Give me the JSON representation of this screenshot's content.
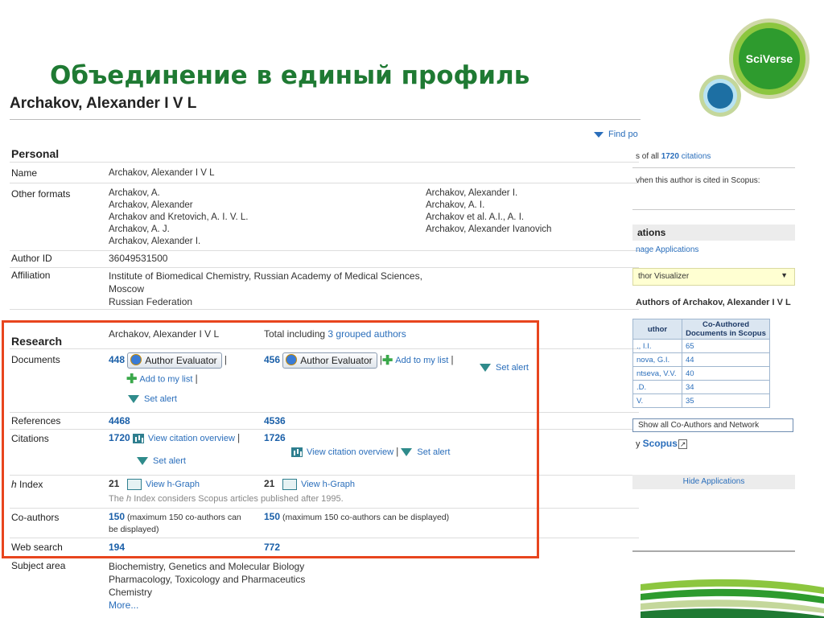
{
  "slide": {
    "title": "Объединение в единый профиль"
  },
  "logo": {
    "text": "SciVerse"
  },
  "profile": {
    "name": "Archakov, Alexander I V L",
    "find_link": "Find po",
    "personal": {
      "heading": "Personal",
      "name_label": "Name",
      "name_value": "Archakov, Alexander I V L",
      "other_formats_label": "Other formats",
      "other_formats_left": [
        "Archakov, A.",
        "Archakov, Alexander",
        "Archakov and Kretovich, A. I. V. L.",
        "Archakov, A. J.",
        "Archakov, Alexander I."
      ],
      "other_formats_right": [
        "Archakov, Alexander I.",
        "Archakov, A. I.",
        "Archakov et al. A.I., A. I.",
        "Archakov, Alexander Ivanovich"
      ],
      "author_id_label": "Author ID",
      "author_id_value": "36049531500",
      "affiliation_label": "Affiliation",
      "affiliation_lines": [
        "Institute of Biomedical Chemistry, Russian Academy of Medical Sciences,",
        "Moscow",
        "Russian Federation"
      ]
    },
    "research": {
      "heading": "Research",
      "col1_header": "Archakov, Alexander I V L",
      "col2_header_prefix": "Total including ",
      "col2_header_link": "3 grouped authors",
      "documents_label": "Documents",
      "documents_col1": "448",
      "documents_col2": "456",
      "author_evaluator": "Author Evaluator",
      "add_to_list": "Add to my list",
      "set_alert": "Set alert",
      "separator": "|",
      "references_label": "References",
      "references_col1": "4468",
      "references_col2": "4536",
      "citations_label": "Citations",
      "citations_col1": "1720",
      "citations_col2": "1726",
      "view_citation_overview": "View citation overview",
      "hindex_label_italic": "h",
      "hindex_label_rest": " Index",
      "hindex_col1": "21",
      "hindex_col2": "21",
      "view_hgraph": "View h-Graph",
      "hindex_note_prefix": "The ",
      "hindex_note_italic": "h",
      "hindex_note_rest": " Index considers Scopus articles published after 1995.",
      "coauthors_label": "Co-authors",
      "coauthors_col1": "150",
      "coauthors_col1_note_a": "(maximum 150 co-authors can",
      "coauthors_col1_note_b": "be displayed)",
      "coauthors_col2": "150",
      "coauthors_col2_note": "(maximum 150 co-authors can be displayed)",
      "websearch_label": "Web search",
      "websearch_col1": "194",
      "websearch_col2": "772"
    },
    "subject": {
      "label": "Subject area",
      "lines": [
        "Biochemistry, Genetics and Molecular Biology",
        "Pharmacology, Toxicology and Pharmaceutics",
        "Chemistry"
      ],
      "more": "More..."
    }
  },
  "right_panel": {
    "citations_prefix": "s of all ",
    "citations_count": "1720",
    "citations_suffix": " citations",
    "alert_text": "vhen this author is cited in Scopus:",
    "apps_heading": "ations",
    "manage_apps": "nage Applications",
    "visualizer": "thor Visualizer",
    "coauthors_title": "Authors of Archakov, Alexander I V L",
    "table_headers": [
      "uthor",
      "Co-Authored Documents in Scopus"
    ],
    "table_rows": [
      [
        "., I.I.",
        "65"
      ],
      [
        "nova, G.I.",
        "44"
      ],
      [
        "ntseva, V.V.",
        "40"
      ],
      [
        ".D.",
        "34"
      ],
      [
        "V.",
        "35"
      ]
    ],
    "show_all": "Show all Co-Authors and Network",
    "by_text": "y ",
    "scopus": "Scopus",
    "hide_apps": "Hide Applications"
  },
  "colors": {
    "title_green": "#1f7a33",
    "highlight_red": "#e8451e",
    "link_blue": "#2a6ebb",
    "number_blue": "#1a5fa8"
  }
}
